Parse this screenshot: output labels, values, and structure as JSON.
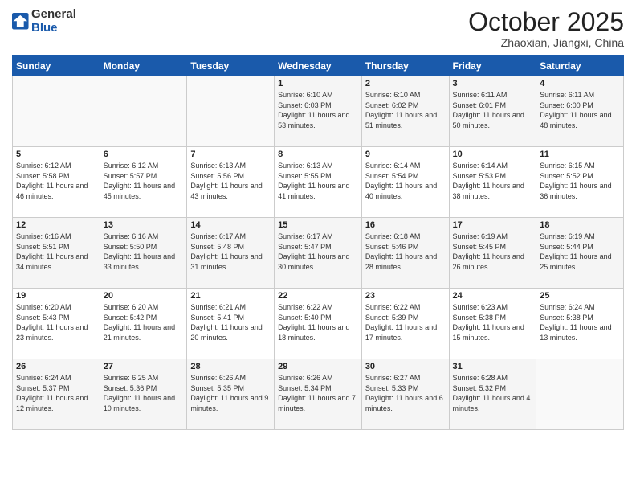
{
  "header": {
    "logo_general": "General",
    "logo_blue": "Blue",
    "month": "October 2025",
    "location": "Zhaoxian, Jiangxi, China"
  },
  "weekdays": [
    "Sunday",
    "Monday",
    "Tuesday",
    "Wednesday",
    "Thursday",
    "Friday",
    "Saturday"
  ],
  "weeks": [
    [
      {
        "day": "",
        "sunrise": "",
        "sunset": "",
        "daylight": ""
      },
      {
        "day": "",
        "sunrise": "",
        "sunset": "",
        "daylight": ""
      },
      {
        "day": "",
        "sunrise": "",
        "sunset": "",
        "daylight": ""
      },
      {
        "day": "1",
        "sunrise": "Sunrise: 6:10 AM",
        "sunset": "Sunset: 6:03 PM",
        "daylight": "Daylight: 11 hours and 53 minutes."
      },
      {
        "day": "2",
        "sunrise": "Sunrise: 6:10 AM",
        "sunset": "Sunset: 6:02 PM",
        "daylight": "Daylight: 11 hours and 51 minutes."
      },
      {
        "day": "3",
        "sunrise": "Sunrise: 6:11 AM",
        "sunset": "Sunset: 6:01 PM",
        "daylight": "Daylight: 11 hours and 50 minutes."
      },
      {
        "day": "4",
        "sunrise": "Sunrise: 6:11 AM",
        "sunset": "Sunset: 6:00 PM",
        "daylight": "Daylight: 11 hours and 48 minutes."
      }
    ],
    [
      {
        "day": "5",
        "sunrise": "Sunrise: 6:12 AM",
        "sunset": "Sunset: 5:58 PM",
        "daylight": "Daylight: 11 hours and 46 minutes."
      },
      {
        "day": "6",
        "sunrise": "Sunrise: 6:12 AM",
        "sunset": "Sunset: 5:57 PM",
        "daylight": "Daylight: 11 hours and 45 minutes."
      },
      {
        "day": "7",
        "sunrise": "Sunrise: 6:13 AM",
        "sunset": "Sunset: 5:56 PM",
        "daylight": "Daylight: 11 hours and 43 minutes."
      },
      {
        "day": "8",
        "sunrise": "Sunrise: 6:13 AM",
        "sunset": "Sunset: 5:55 PM",
        "daylight": "Daylight: 11 hours and 41 minutes."
      },
      {
        "day": "9",
        "sunrise": "Sunrise: 6:14 AM",
        "sunset": "Sunset: 5:54 PM",
        "daylight": "Daylight: 11 hours and 40 minutes."
      },
      {
        "day": "10",
        "sunrise": "Sunrise: 6:14 AM",
        "sunset": "Sunset: 5:53 PM",
        "daylight": "Daylight: 11 hours and 38 minutes."
      },
      {
        "day": "11",
        "sunrise": "Sunrise: 6:15 AM",
        "sunset": "Sunset: 5:52 PM",
        "daylight": "Daylight: 11 hours and 36 minutes."
      }
    ],
    [
      {
        "day": "12",
        "sunrise": "Sunrise: 6:16 AM",
        "sunset": "Sunset: 5:51 PM",
        "daylight": "Daylight: 11 hours and 34 minutes."
      },
      {
        "day": "13",
        "sunrise": "Sunrise: 6:16 AM",
        "sunset": "Sunset: 5:50 PM",
        "daylight": "Daylight: 11 hours and 33 minutes."
      },
      {
        "day": "14",
        "sunrise": "Sunrise: 6:17 AM",
        "sunset": "Sunset: 5:48 PM",
        "daylight": "Daylight: 11 hours and 31 minutes."
      },
      {
        "day": "15",
        "sunrise": "Sunrise: 6:17 AM",
        "sunset": "Sunset: 5:47 PM",
        "daylight": "Daylight: 11 hours and 30 minutes."
      },
      {
        "day": "16",
        "sunrise": "Sunrise: 6:18 AM",
        "sunset": "Sunset: 5:46 PM",
        "daylight": "Daylight: 11 hours and 28 minutes."
      },
      {
        "day": "17",
        "sunrise": "Sunrise: 6:19 AM",
        "sunset": "Sunset: 5:45 PM",
        "daylight": "Daylight: 11 hours and 26 minutes."
      },
      {
        "day": "18",
        "sunrise": "Sunrise: 6:19 AM",
        "sunset": "Sunset: 5:44 PM",
        "daylight": "Daylight: 11 hours and 25 minutes."
      }
    ],
    [
      {
        "day": "19",
        "sunrise": "Sunrise: 6:20 AM",
        "sunset": "Sunset: 5:43 PM",
        "daylight": "Daylight: 11 hours and 23 minutes."
      },
      {
        "day": "20",
        "sunrise": "Sunrise: 6:20 AM",
        "sunset": "Sunset: 5:42 PM",
        "daylight": "Daylight: 11 hours and 21 minutes."
      },
      {
        "day": "21",
        "sunrise": "Sunrise: 6:21 AM",
        "sunset": "Sunset: 5:41 PM",
        "daylight": "Daylight: 11 hours and 20 minutes."
      },
      {
        "day": "22",
        "sunrise": "Sunrise: 6:22 AM",
        "sunset": "Sunset: 5:40 PM",
        "daylight": "Daylight: 11 hours and 18 minutes."
      },
      {
        "day": "23",
        "sunrise": "Sunrise: 6:22 AM",
        "sunset": "Sunset: 5:39 PM",
        "daylight": "Daylight: 11 hours and 17 minutes."
      },
      {
        "day": "24",
        "sunrise": "Sunrise: 6:23 AM",
        "sunset": "Sunset: 5:38 PM",
        "daylight": "Daylight: 11 hours and 15 minutes."
      },
      {
        "day": "25",
        "sunrise": "Sunrise: 6:24 AM",
        "sunset": "Sunset: 5:38 PM",
        "daylight": "Daylight: 11 hours and 13 minutes."
      }
    ],
    [
      {
        "day": "26",
        "sunrise": "Sunrise: 6:24 AM",
        "sunset": "Sunset: 5:37 PM",
        "daylight": "Daylight: 11 hours and 12 minutes."
      },
      {
        "day": "27",
        "sunrise": "Sunrise: 6:25 AM",
        "sunset": "Sunset: 5:36 PM",
        "daylight": "Daylight: 11 hours and 10 minutes."
      },
      {
        "day": "28",
        "sunrise": "Sunrise: 6:26 AM",
        "sunset": "Sunset: 5:35 PM",
        "daylight": "Daylight: 11 hours and 9 minutes."
      },
      {
        "day": "29",
        "sunrise": "Sunrise: 6:26 AM",
        "sunset": "Sunset: 5:34 PM",
        "daylight": "Daylight: 11 hours and 7 minutes."
      },
      {
        "day": "30",
        "sunrise": "Sunrise: 6:27 AM",
        "sunset": "Sunset: 5:33 PM",
        "daylight": "Daylight: 11 hours and 6 minutes."
      },
      {
        "day": "31",
        "sunrise": "Sunrise: 6:28 AM",
        "sunset": "Sunset: 5:32 PM",
        "daylight": "Daylight: 11 hours and 4 minutes."
      },
      {
        "day": "",
        "sunrise": "",
        "sunset": "",
        "daylight": ""
      }
    ]
  ]
}
